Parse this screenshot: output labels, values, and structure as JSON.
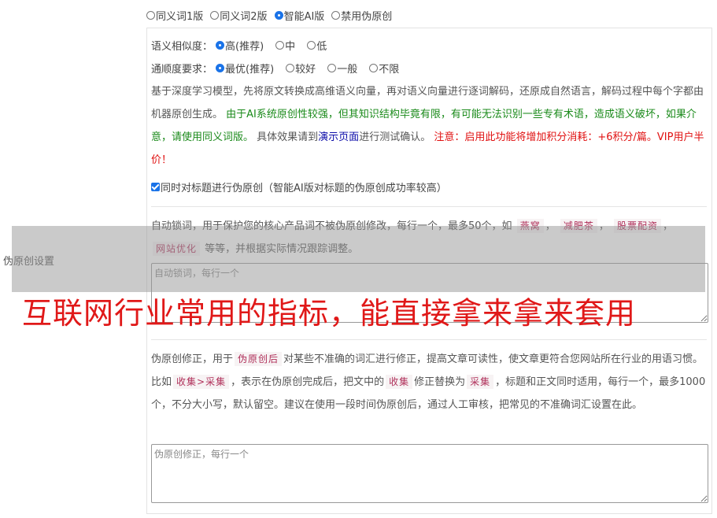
{
  "versions": {
    "options": [
      "同义词1版",
      "同义词2版",
      "智能AI版",
      "禁用伪原创"
    ],
    "selected": "智能AI版"
  },
  "side_label": "伪原创设置",
  "similarity": {
    "label": "语义相似度：",
    "options": [
      "高(推荐)",
      "中",
      "低"
    ],
    "selected": "高(推荐)"
  },
  "fluency": {
    "label": "通顺度要求：",
    "options": [
      "最优(推荐)",
      "较好",
      "一般",
      "不限"
    ],
    "selected": "最优(推荐)"
  },
  "description": {
    "part1": "基于深度学习模型，先将原文转换成高维语义向量，再对语义向量进行逐词解码，还原成自然语言，解码过程中每个字都由机器原创生成。",
    "part2_green": "由于AI系统原创性较强，但其知识结构毕竟有限，有可能无法识别一些专有术语，造成语义破坏，如果介意，请使用同义词版。",
    "part3": "具体效果请到",
    "link": "演示页面",
    "part4": "进行测试确认。",
    "warning": "注意：启用此功能将增加积分消耗：+6积分/篇。VIP用户半价！"
  },
  "title_checkbox": {
    "label": "同时对标题进行伪原创（智能AI版对标题的伪原创成功率较高）",
    "checked": true
  },
  "lock_words": {
    "intro": "自动锁词，用于保护您的核心产品词不被伪原创修改，每行一个，最多50个，如",
    "tags": [
      "燕窝",
      "减肥茶",
      "股票配资",
      "网站优化"
    ],
    "outro": "等等，并根据实际情况跟踪调整。",
    "placeholder": "自动锁词，每行一个"
  },
  "correction": {
    "intro1": "伪原创修正，用于",
    "tag1": "伪原创后",
    "intro2": "对某些不准确的词汇进行修正，提高文章可读性，使文章更符合您网站所在行业的用语习惯。比如",
    "tag2": "收集>采集",
    "intro3": "，表示在伪原创完成后，把文中的",
    "tag3": "收集",
    "intro4": "修正替换为",
    "tag4": "采集",
    "intro5": "，标题和正文同时适用，每行一个，最多1000个，不分大小写，默认留空。建议在使用一段时间伪原创后，通过人工审核，把常见的不准确词汇设置在此。",
    "placeholder": "伪原创修正，每行一个"
  },
  "overlay_caption": "互联网行业常用的指标，能直接拿来拿来套用"
}
